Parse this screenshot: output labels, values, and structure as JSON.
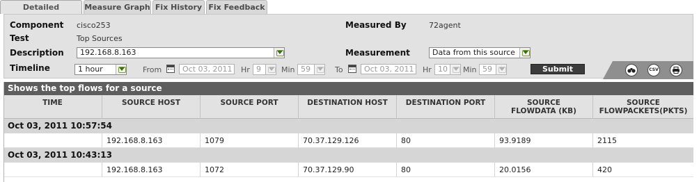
{
  "tabs": [
    {
      "label": "Detailed Diagnosis",
      "active": true
    },
    {
      "label": "Measure Graph",
      "active": false
    },
    {
      "label": "Fix History",
      "active": false
    },
    {
      "label": "Fix Feedback",
      "active": false
    }
  ],
  "form": {
    "component_label": "Component",
    "component_value": "cisco253",
    "measured_by_label": "Measured By",
    "measured_by_value": "72agent",
    "test_label": "Test",
    "test_value": "Top Sources",
    "description_label": "Description",
    "description_value": "192.168.8.163",
    "measurement_label": "Measurement",
    "measurement_value": "Data from this source",
    "timeline_label": "Timeline",
    "timeline_value": "1 hour",
    "from_label": "From",
    "from_date": "Oct 03, 2011",
    "from_hr_label": "Hr",
    "from_hr": "9",
    "from_min_label": "Min",
    "from_min": "59",
    "to_label": "To",
    "to_date": "Oct 03, 2011",
    "to_hr_label": "Hr",
    "to_hr": "10",
    "to_min_label": "Min",
    "to_min": "59",
    "submit_label": "Submit"
  },
  "icons": {
    "find": "binoculars-icon",
    "csv": "CSV",
    "print": "printer-icon"
  },
  "table": {
    "title": "Shows the top flows for a source",
    "headers": [
      "TIME",
      "SOURCE HOST",
      "SOURCE PORT",
      "DESTINATION HOST",
      "DESTINATION PORT",
      "SOURCE FLOWDATA (KB)",
      "SOURCE FLOWPACKETS(PKTS)"
    ],
    "groups": [
      {
        "time": "Oct 03, 2011 10:57:54",
        "row": [
          "",
          "192.168.8.163",
          "1079",
          "70.37.129.126",
          "80",
          "93.9189",
          "2115"
        ]
      },
      {
        "time": "Oct 03, 2011 10:43:13",
        "row": [
          "",
          "192.168.8.163",
          "1072",
          "70.37.129.90",
          "80",
          "20.0156",
          "420"
        ]
      }
    ]
  }
}
